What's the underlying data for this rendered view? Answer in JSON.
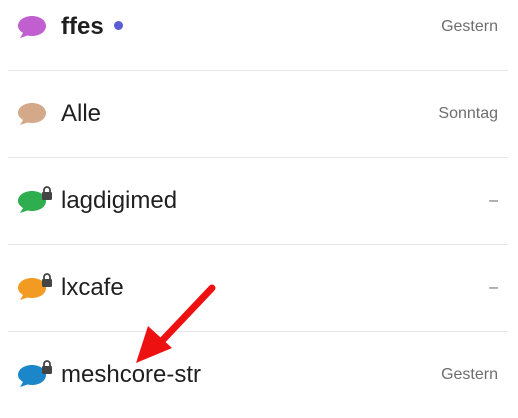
{
  "channels": [
    {
      "name": "ffes",
      "time": "Gestern",
      "bubble_color": "#c25fd0",
      "locked": false,
      "bold": true,
      "unread_dot_color": "#5b5bd6"
    },
    {
      "name": "Alle",
      "time": "Sonntag",
      "bubble_color": "#d4a98a",
      "locked": false,
      "bold": false
    },
    {
      "name": "lagdigimed",
      "time": "–",
      "bubble_color": "#2fae4f",
      "locked": true,
      "bold": false
    },
    {
      "name": "lxcafe",
      "time": "–",
      "bubble_color": "#f29a22",
      "locked": true,
      "bold": false
    },
    {
      "name": "meshcore-str",
      "time": "Gestern",
      "bubble_color": "#1b86c9",
      "locked": true,
      "bold": false
    }
  ],
  "annotation": {
    "arrow_color": "#ee1111",
    "arrow_icon": "red-arrow-icon"
  }
}
